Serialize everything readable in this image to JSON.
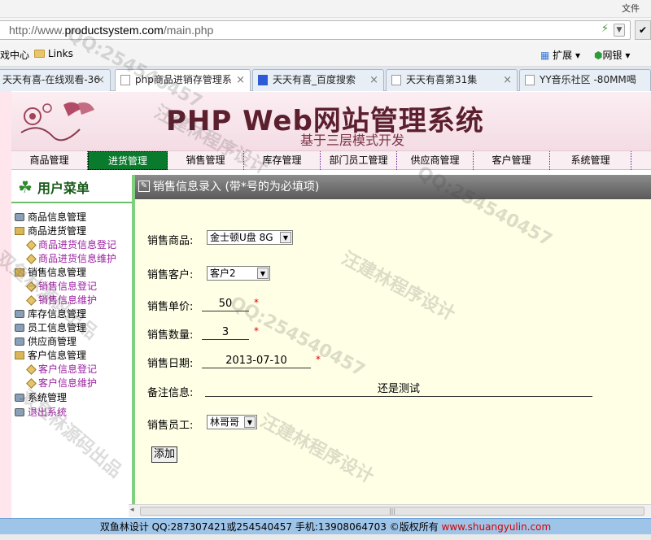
{
  "browser": {
    "top_right_label": "文件",
    "url_prefix": "http://www.",
    "url_domain": "productsystem.com",
    "url_path": "/main.php",
    "favorites_left": "戏中心",
    "favorites_links": "Links",
    "fav_ext": "扩展",
    "fav_bank": "网银",
    "tabs": [
      {
        "label": "天天有喜-在线观看-36",
        "active": false
      },
      {
        "label": "php商品进销存管理系",
        "active": true
      },
      {
        "label": "天天有喜_百度搜索",
        "active": false
      },
      {
        "label": "天天有喜第31集",
        "active": false
      },
      {
        "label": "YY音乐社区 -80MM喝",
        "active": false
      }
    ]
  },
  "banner": {
    "title": "PHP Web网站管理系统",
    "subtitle": "基于三层模式开发"
  },
  "nav": [
    {
      "label": "商品管理",
      "active": false
    },
    {
      "label": "进货管理",
      "active": true
    },
    {
      "label": "销售管理",
      "active": false
    },
    {
      "label": "库存管理",
      "active": false
    },
    {
      "label": "部门员工管理",
      "active": false
    },
    {
      "label": "供应商管理",
      "active": false
    },
    {
      "label": "客户管理",
      "active": false
    },
    {
      "label": "系统管理",
      "active": false
    }
  ],
  "sidebar": {
    "title": "用户菜单",
    "items": [
      {
        "label": "商品信息管理",
        "level": 0,
        "icon": "db"
      },
      {
        "label": "商品进货管理",
        "level": 0,
        "icon": "folder"
      },
      {
        "label": "商品进货信息登记",
        "level": 1,
        "icon": "leaf",
        "link": true
      },
      {
        "label": "商品进货信息维护",
        "level": 1,
        "icon": "leaf",
        "link": true
      },
      {
        "label": "销售信息管理",
        "level": 0,
        "icon": "folder"
      },
      {
        "label": "销售信息登记",
        "level": 1,
        "icon": "leaf",
        "link": true
      },
      {
        "label": "销售信息维护",
        "level": 1,
        "icon": "leaf",
        "link": true
      },
      {
        "label": "库存信息管理",
        "level": 0,
        "icon": "db"
      },
      {
        "label": "员工信息管理",
        "level": 0,
        "icon": "db"
      },
      {
        "label": "供应商管理",
        "level": 0,
        "icon": "db"
      },
      {
        "label": "客户信息管理",
        "level": 0,
        "icon": "folder"
      },
      {
        "label": "客户信息登记",
        "level": 1,
        "icon": "leaf",
        "link": true
      },
      {
        "label": "客户信息维护",
        "level": 1,
        "icon": "leaf",
        "link": true
      },
      {
        "label": "系统管理",
        "level": 0,
        "icon": "db"
      },
      {
        "label": "退出系统",
        "level": 0,
        "icon": "db",
        "link": true
      }
    ]
  },
  "form": {
    "heading": "销售信息录入 (带*号的为必填项)",
    "product_label": "销售商品:",
    "product_value": "金士顿U盘 8G",
    "customer_label": "销售客户:",
    "customer_value": "客户2",
    "price_label": "销售单价:",
    "price_value": "50",
    "qty_label": "销售数量:",
    "qty_value": "3",
    "date_label": "销售日期:",
    "date_value": "2013-07-10",
    "note_label": "备注信息:",
    "note_value": "还是测试",
    "employee_label": "销售员工:",
    "employee_value": "林哥哥",
    "required_mark": "*",
    "submit_label": "添加"
  },
  "footer": {
    "text": "双鱼林设计 QQ:287307421或254540457 手机:13908064703 ©版权所有 ",
    "link": "www.shuangyulin.com"
  },
  "watermarks": [
    "QQ:254540457",
    "汪建林程序设计",
    "双鱼林源码出品",
    "QQ:254540457",
    "汪建林程序设计",
    "QQ:254540457",
    "双鱼林源码出品",
    "汪建林程序设计"
  ]
}
